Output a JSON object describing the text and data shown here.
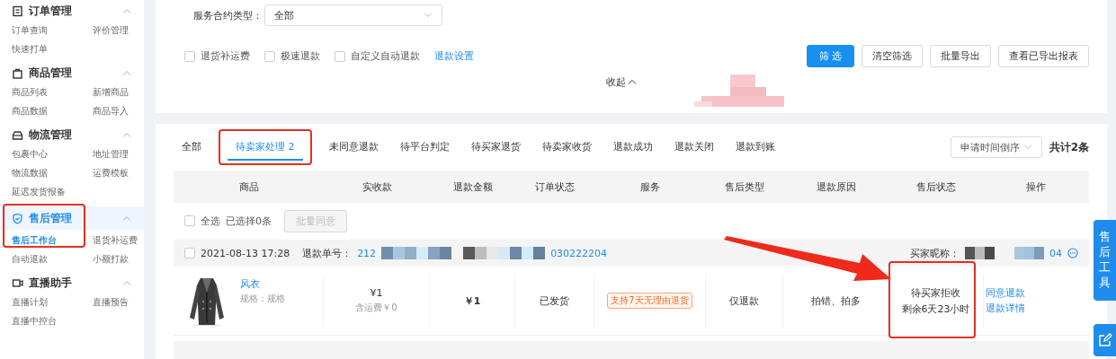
{
  "sidebar": {
    "groups": [
      {
        "title": "订单管理",
        "expanded": true,
        "selected": false,
        "highlighted": false,
        "items": [
          {
            "label": "订单查询",
            "selected": false
          },
          {
            "label": "评价管理",
            "selected": false
          },
          {
            "label": "快速打单",
            "selected": false
          }
        ]
      },
      {
        "title": "商品管理",
        "expanded": true,
        "selected": false,
        "highlighted": false,
        "items": [
          {
            "label": "商品列表",
            "selected": false
          },
          {
            "label": "新增商品",
            "selected": false
          },
          {
            "label": "商品数据",
            "selected": false
          },
          {
            "label": "商品导入",
            "selected": false
          }
        ]
      },
      {
        "title": "物流管理",
        "expanded": true,
        "selected": false,
        "highlighted": false,
        "items": [
          {
            "label": "包裹中心",
            "selected": false
          },
          {
            "label": "地址管理",
            "selected": false
          },
          {
            "label": "物流数据",
            "selected": false
          },
          {
            "label": "运费模板",
            "selected": false
          },
          {
            "label": "延迟发货报备",
            "selected": false
          }
        ]
      },
      {
        "title": "售后管理",
        "expanded": true,
        "selected": true,
        "highlighted": true,
        "items": [
          {
            "label": "售后工作台",
            "selected": true
          },
          {
            "label": "退货补运费",
            "selected": false
          },
          {
            "label": "自动退款",
            "selected": false
          },
          {
            "label": "小额打款",
            "selected": false
          }
        ]
      },
      {
        "title": "直播助手",
        "expanded": true,
        "selected": false,
        "highlighted": false,
        "items": [
          {
            "label": "直播计划",
            "selected": false
          },
          {
            "label": "直播预告",
            "selected": false
          },
          {
            "label": "直播中控台",
            "selected": false
          }
        ]
      }
    ]
  },
  "filters": {
    "contract_type": {
      "label": "服务合约类型：",
      "value": "全部"
    },
    "checkboxes": [
      {
        "label": "退货补运费",
        "checked": false
      },
      {
        "label": "极速退款",
        "checked": false
      },
      {
        "label": "自定义自动退款",
        "checked": false
      }
    ],
    "settings_link": "退款设置",
    "buttons": [
      {
        "label": "筛 选",
        "kind": "primary"
      },
      {
        "label": "清空筛选",
        "kind": "default"
      },
      {
        "label": "批量导出",
        "kind": "default"
      },
      {
        "label": "查看已导出报表",
        "kind": "default"
      }
    ],
    "collapse": "收起"
  },
  "tabs": [
    {
      "label": "全部",
      "selected": false,
      "highlighted": false
    },
    {
      "label": "待卖家处理 2",
      "selected": true,
      "highlighted": true
    },
    {
      "label": "未同意退款",
      "selected": false,
      "highlighted": false
    },
    {
      "label": "待平台判定",
      "selected": false,
      "highlighted": false
    },
    {
      "label": "待买家退货",
      "selected": false,
      "highlighted": false
    },
    {
      "label": "待卖家收货",
      "selected": false,
      "highlighted": false
    },
    {
      "label": "退款成功",
      "selected": false,
      "highlighted": false
    },
    {
      "label": "退款关闭",
      "selected": false,
      "highlighted": false
    },
    {
      "label": "退款到账",
      "selected": false,
      "highlighted": false
    }
  ],
  "sort": {
    "value": "申请时间倒序"
  },
  "total": "共计2条",
  "table": {
    "columns": [
      "商品",
      "实收款",
      "退款金额",
      "订单状态",
      "服务",
      "售后类型",
      "退款原因",
      "售后状态",
      "操作"
    ],
    "select_all": {
      "label": "全选",
      "checked": false
    },
    "selected_count": "已选择0条",
    "batch_button": {
      "label": "批量同意",
      "disabled": true
    },
    "orders": [
      {
        "checked": false,
        "time": "2021-08-13 17:28",
        "refund_no_label": "退款单号：",
        "refund_no_start": "212",
        "refund_no_end": "030222204",
        "buyer_label": "买家昵称：",
        "buyer_end": "04",
        "product": {
          "name": "风衣",
          "spec": "规格：规格"
        },
        "received": "¥1",
        "shipping": "含运费￥0",
        "refund": "￥1",
        "order_status": "已发货",
        "service_tag": "支持7天无理由退货",
        "type": "仅退款",
        "reason": "拍错、拍多",
        "status_lines": [
          "待买家拒收",
          "剩余6天23小时"
        ],
        "status_highlighted": true,
        "actions": [
          "同意退款",
          "退款详情"
        ]
      }
    ]
  },
  "side_tools": {
    "label": "售后工具"
  },
  "annotation_arrow": true
}
